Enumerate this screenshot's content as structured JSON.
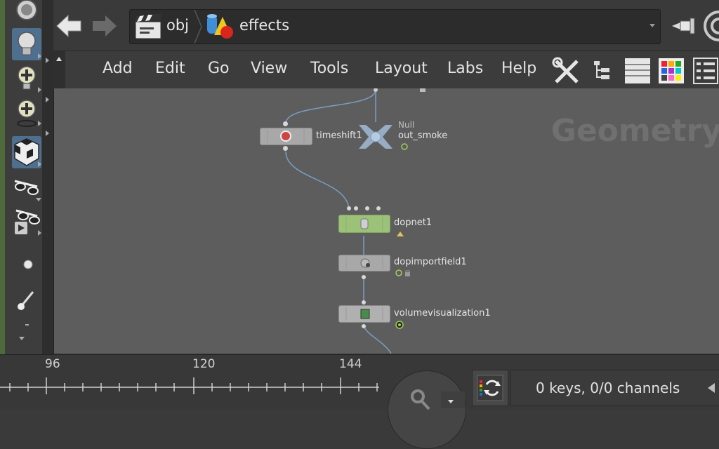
{
  "breadcrumb": {
    "level1": "obj",
    "level2": "effects"
  },
  "menu": {
    "items": [
      "Add",
      "Edit",
      "Go",
      "View",
      "Tools",
      "Layout",
      "Labs",
      "Help"
    ]
  },
  "network": {
    "watermark": "Geometry",
    "nodes": {
      "timeshift": {
        "name": "timeshift1"
      },
      "null": {
        "type": "Null",
        "name": "out_smoke"
      },
      "dopnet": {
        "name": "dopnet1"
      },
      "dopimportfield": {
        "name": "dopimportfield1"
      },
      "volviz": {
        "name": "volumevisualization1"
      }
    }
  },
  "timeline": {
    "ticks": [
      "96",
      "120",
      "144"
    ],
    "keys_status": "0 keys, 0/0 channels"
  },
  "colors": {
    "network_bg": "#5d5d5d",
    "node_green": "#9cc27a",
    "wire": "#7a9ec4",
    "active_tool": "#4f6f8f"
  },
  "icons": {
    "left_shelf": [
      "view-tool-icon",
      "light-icon",
      "add-light-icon",
      "spot-light-icon",
      "checker-cube-icon",
      "stereo-glasses-icon",
      "stereo-play-icon",
      "dot-icon",
      "brush-icon"
    ],
    "top_right": [
      "pin-icon",
      "spiral-icon"
    ],
    "menu_right": [
      "tools-icon",
      "tree-icon",
      "list-view-icon",
      "color-palette-icon",
      "grid-layout-icon"
    ]
  }
}
